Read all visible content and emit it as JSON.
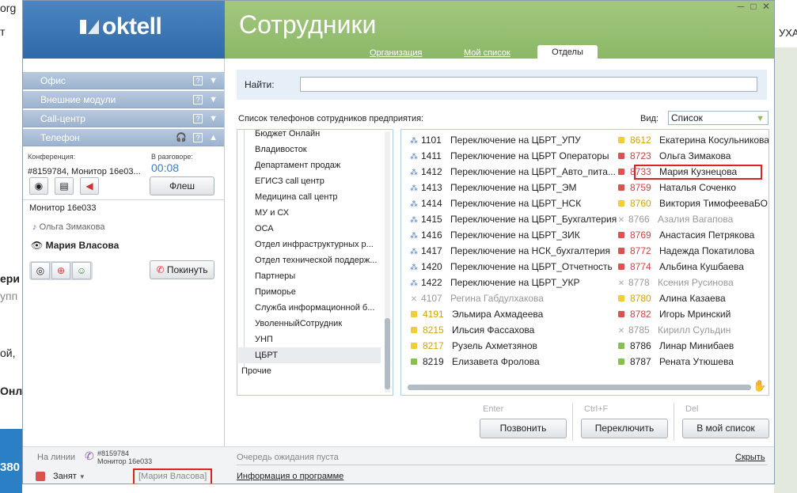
{
  "background": {
    "left_top_text": "org",
    "left_letter": "т",
    "left_texts": [
      "ери",
      "упп",
      "ой,",
      "Онл"
    ],
    "blue_text": "380",
    "right_text": "УХА"
  },
  "window": {
    "logo": "oktell",
    "title": "Сотрудники",
    "tabs": [
      {
        "label": "Организация"
      },
      {
        "label": "Мой список"
      },
      {
        "label": "Отделы"
      }
    ]
  },
  "left_panel": {
    "accordion": [
      {
        "label": "Офис"
      },
      {
        "label": "Внешние модули"
      },
      {
        "label": "Call-центр"
      },
      {
        "label": "Телефон"
      }
    ],
    "conference_label": "Конференция:",
    "conference_value": "#8159784,  Монитор  16e03...",
    "talking_label": "В разговоре:",
    "talking_time": "00:08",
    "flash_button": "Флеш",
    "monitor_line": "Монитор 16e033",
    "participant_1": "Ольга Зимакова",
    "participant_2": "Мария Власова",
    "leave_button": "Покинуть"
  },
  "status_bar": {
    "on_line_label": "На линии",
    "line_number": "#8159784",
    "line_monitor": "Монитор 16e033",
    "status": "Занят",
    "user": "[Мария Власова]",
    "queue": "Очередь ожидания пуста",
    "about": "Информация о программе",
    "hide": "Скрыть"
  },
  "main": {
    "search_label": "Найти:",
    "search_value": "",
    "list_caption": "Список телефонов сотрудников предприятия:",
    "view_label": "Вид:",
    "view_value": "Список",
    "departments": [
      {
        "name": "Бюджет Онлайн"
      },
      {
        "name": "Владивосток"
      },
      {
        "name": "Департамент продаж"
      },
      {
        "name": "ЕГИСЗ call центр"
      },
      {
        "name": "Медицина call центр"
      },
      {
        "name": "МУ и СХ"
      },
      {
        "name": "ОСА"
      },
      {
        "name": "Отдел инфраструктурных р..."
      },
      {
        "name": "Отдел технической поддерж..."
      },
      {
        "name": "Партнеры"
      },
      {
        "name": "Приморье"
      },
      {
        "name": "Служба информационной б..."
      },
      {
        "name": "УволенныйСотрудник"
      },
      {
        "name": "УНП"
      },
      {
        "name": "ЦБРТ"
      },
      {
        "name": "Прочие"
      }
    ],
    "employees_left": [
      {
        "num": "1101",
        "name": "Переключение на ЦБРТ_УПУ",
        "type": "group"
      },
      {
        "num": "1411",
        "name": "Переключение на ЦБРТ Операторы",
        "type": "group"
      },
      {
        "num": "1412",
        "name": "Переключение на ЦБРТ_Авто_пита...",
        "type": "group"
      },
      {
        "num": "1413",
        "name": "Переключение на ЦБРТ_ЭМ",
        "type": "group"
      },
      {
        "num": "1414",
        "name": "Переключение на ЦБРТ_НСК",
        "type": "group"
      },
      {
        "num": "1415",
        "name": "Переключение на ЦБРТ_Бухгалтерия",
        "type": "group"
      },
      {
        "num": "1416",
        "name": "Переключение на ЦБРТ_ЗИК",
        "type": "group"
      },
      {
        "num": "1417",
        "name": "Переключение на НСК_бухгалтерия",
        "type": "group"
      },
      {
        "num": "1420",
        "name": "Переключение на ЦБРТ_Отчетность",
        "type": "group"
      },
      {
        "num": "1422",
        "name": "Переключение на ЦБРТ_УКР",
        "type": "group"
      },
      {
        "num": "4107",
        "name": "Регина Габдулхакова",
        "type": "off"
      },
      {
        "num": "4191",
        "name": "Эльмира Ахмадеева",
        "type": "away"
      },
      {
        "num": "8215",
        "name": "Ильсия Фассахова",
        "type": "away"
      },
      {
        "num": "8217",
        "name": "Рузель Ахметзянов",
        "type": "away"
      },
      {
        "num": "8219",
        "name": "Елизавета Фролова",
        "type": "free"
      }
    ],
    "employees_right": [
      {
        "num": "8612",
        "name": "Екатерина Косульникова",
        "type": "away"
      },
      {
        "num": "8723",
        "name": "Ольга Зимакова",
        "type": "busy"
      },
      {
        "num": "8733",
        "name": "Мария Кузнецова",
        "type": "busy"
      },
      {
        "num": "8759",
        "name": "Наталья Соченко",
        "type": "busy"
      },
      {
        "num": "8760",
        "name": "Виктория ТимофееваБО",
        "type": "away"
      },
      {
        "num": "8766",
        "name": "Азалия Вагапова",
        "type": "off"
      },
      {
        "num": "8769",
        "name": "Анастасия Петрякова",
        "type": "busy"
      },
      {
        "num": "8772",
        "name": "Надежда Покатилова",
        "type": "busy"
      },
      {
        "num": "8774",
        "name": "Альбина Кушбаева",
        "type": "busy"
      },
      {
        "num": "8778",
        "name": "Ксения Русинова",
        "type": "off"
      },
      {
        "num": "8780",
        "name": "Алина Казаева",
        "type": "away"
      },
      {
        "num": "8782",
        "name": "Игорь Мринский",
        "type": "busy"
      },
      {
        "num": "8785",
        "name": "Кирилл Сульдин",
        "type": "off"
      },
      {
        "num": "8786",
        "name": "Линар Минибаев",
        "type": "free"
      },
      {
        "num": "8787",
        "name": "Рената Утюшева",
        "type": "free"
      }
    ],
    "actions": [
      {
        "hint": "Enter",
        "label": "Позвонить"
      },
      {
        "hint": "Ctrl+F",
        "label": "Переключить"
      },
      {
        "hint": "Del",
        "label": "В мой список"
      }
    ]
  },
  "colors": {
    "busy": "#d9534f",
    "away": "#f2cc3a",
    "free": "#86c04f",
    "off": "#b0b0b0",
    "header_green": "#94be71",
    "header_blue": "#3b78b8"
  }
}
